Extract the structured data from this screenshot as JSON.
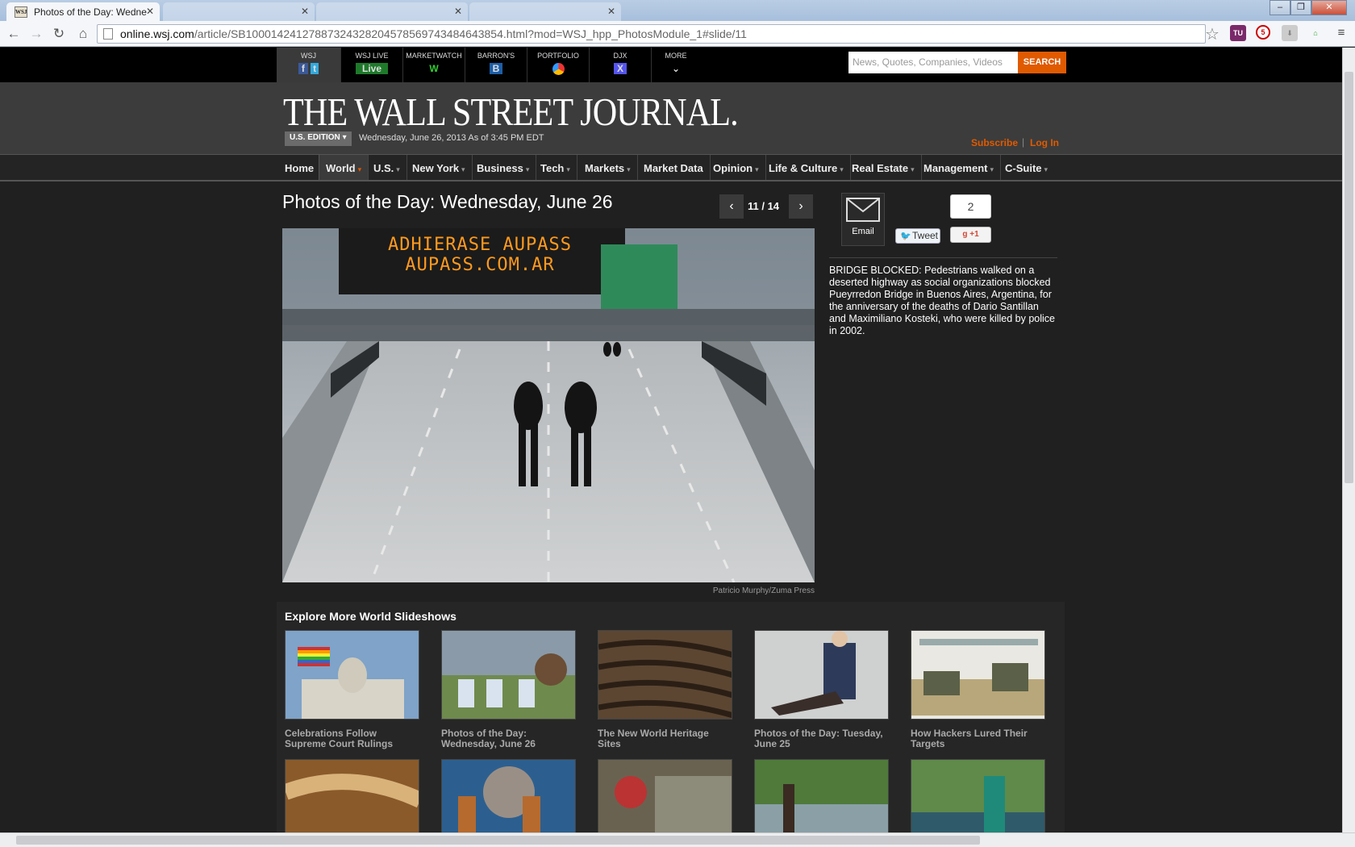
{
  "browser": {
    "active_tab_title": "Photos of the Day: Wedne",
    "tab_favicon_text": "WSJ",
    "inactive_tabs": [
      "",
      "",
      ""
    ],
    "url_host": "online.wsj.com",
    "url_path": "/article/SB10001424127887324328204578569743484643854.html?mod=WSJ_hpp_PhotosModule_1#slide/11",
    "extension_badges": [
      "TU",
      "5"
    ]
  },
  "properties": [
    {
      "label": "WSJ",
      "icon": "facebook-twitter-icons"
    },
    {
      "label": "WSJ LIVE",
      "logo": "Live"
    },
    {
      "label": "MARKETWATCH",
      "logo": "W"
    },
    {
      "label": "BARRON'S",
      "logo": "B"
    },
    {
      "label": "PORTFOLIO",
      "logo": "portfolio-icon"
    },
    {
      "label": "DJX",
      "logo": "X"
    },
    {
      "label": "MORE",
      "logo": "chevron-down-icon"
    }
  ],
  "search": {
    "placeholder": "News, Quotes, Companies, Videos",
    "button": "SEARCH"
  },
  "masthead": {
    "logo": "THE WALL STREET JOURNAL.",
    "edition": "U.S. EDITION",
    "date": "Wednesday, June 26, 2013 As of 3:45 PM EDT",
    "subscribe": "Subscribe",
    "login": "Log In"
  },
  "nav": [
    {
      "label": "Home",
      "caret": false
    },
    {
      "label": "World",
      "caret": true,
      "active": true
    },
    {
      "label": "U.S.",
      "caret": true
    },
    {
      "label": "New York",
      "caret": true
    },
    {
      "label": "Business",
      "caret": true
    },
    {
      "label": "Tech",
      "caret": true
    },
    {
      "label": "Markets",
      "caret": true
    },
    {
      "label": "Market Data",
      "caret": false
    },
    {
      "label": "Opinion",
      "caret": true
    },
    {
      "label": "Life & Culture",
      "caret": true
    },
    {
      "label": "Real Estate",
      "caret": true
    },
    {
      "label": "Management",
      "caret": true
    },
    {
      "label": "C-Suite",
      "caret": true
    }
  ],
  "slideshow": {
    "title": "Photos of the Day: Wednesday, June 26",
    "counter": "11 / 14",
    "sign_line1": "ADHIERASE AUPASS",
    "sign_line2": "AUPASS.COM.AR",
    "credit": "Patricio Murphy/Zuma Press",
    "caption": "BRIDGE BLOCKED: Pedestrians walked on a deserted highway as social organizations blocked Pueyrredon Bridge in Buenos Aires, Argentina, for the anniversary of the deaths of Dario Santillan and Maximiliano Kosteki, who were killed by police in 2002."
  },
  "share": {
    "email": "Email",
    "tweet": "Tweet",
    "gplus_count": "2",
    "gplus": "+1"
  },
  "explore": {
    "heading": "Explore More World Slideshows",
    "items": [
      {
        "title": "Celebrations Follow Supreme Court Rulings"
      },
      {
        "title": "Photos of the Day: Wednesday, June 26"
      },
      {
        "title": "The New World Heritage Sites"
      },
      {
        "title": "Photos of the Day: Tuesday, June 25"
      },
      {
        "title": "How Hackers Lured Their Targets"
      },
      {
        "title": ""
      },
      {
        "title": ""
      },
      {
        "title": ""
      },
      {
        "title": ""
      },
      {
        "title": ""
      }
    ]
  },
  "colors": {
    "accent": "#e05a00",
    "background": "#202020",
    "masthead": "#3c3c3c"
  }
}
